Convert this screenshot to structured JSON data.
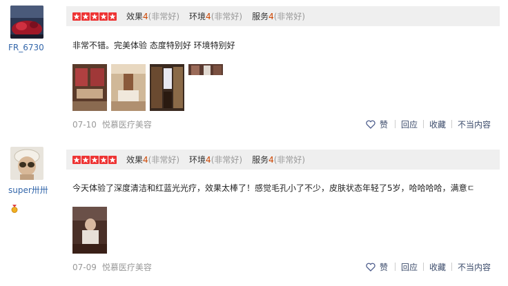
{
  "reviews": [
    {
      "username": "FR_6730",
      "ratings": [
        {
          "label": "效果",
          "score": "4",
          "desc": "(非常好)"
        },
        {
          "label": "环境",
          "score": "4",
          "desc": "(非常好)"
        },
        {
          "label": "服务",
          "score": "4",
          "desc": "(非常好)"
        }
      ],
      "text": "非常不错。完美体验 态度特别好 环境特别好",
      "date": "07-10",
      "shop": "悦慕医疗美容",
      "actions": {
        "like": "赞",
        "reply": "回应",
        "favorite": "收藏",
        "report": "不当内容"
      }
    },
    {
      "username": "super卅卅",
      "ratings": [
        {
          "label": "效果",
          "score": "4",
          "desc": "(非常好)"
        },
        {
          "label": "环境",
          "score": "4",
          "desc": "(非常好)"
        },
        {
          "label": "服务",
          "score": "4",
          "desc": "(非常好)"
        }
      ],
      "text": "今天体验了深度清洁和红蓝光光疗，效果太棒了！感觉毛孔小了不少，皮肤状态年轻了5岁，哈哈哈哈，满意ㄷ",
      "date": "07-09",
      "shop": "悦慕医疗美容",
      "actions": {
        "like": "赞",
        "reply": "回应",
        "favorite": "收藏",
        "report": "不当内容"
      }
    }
  ],
  "colors": {
    "star": "#ee3333",
    "link": "#3366aa",
    "rating_bar_bg": "#efefef",
    "meta": "#999999"
  }
}
